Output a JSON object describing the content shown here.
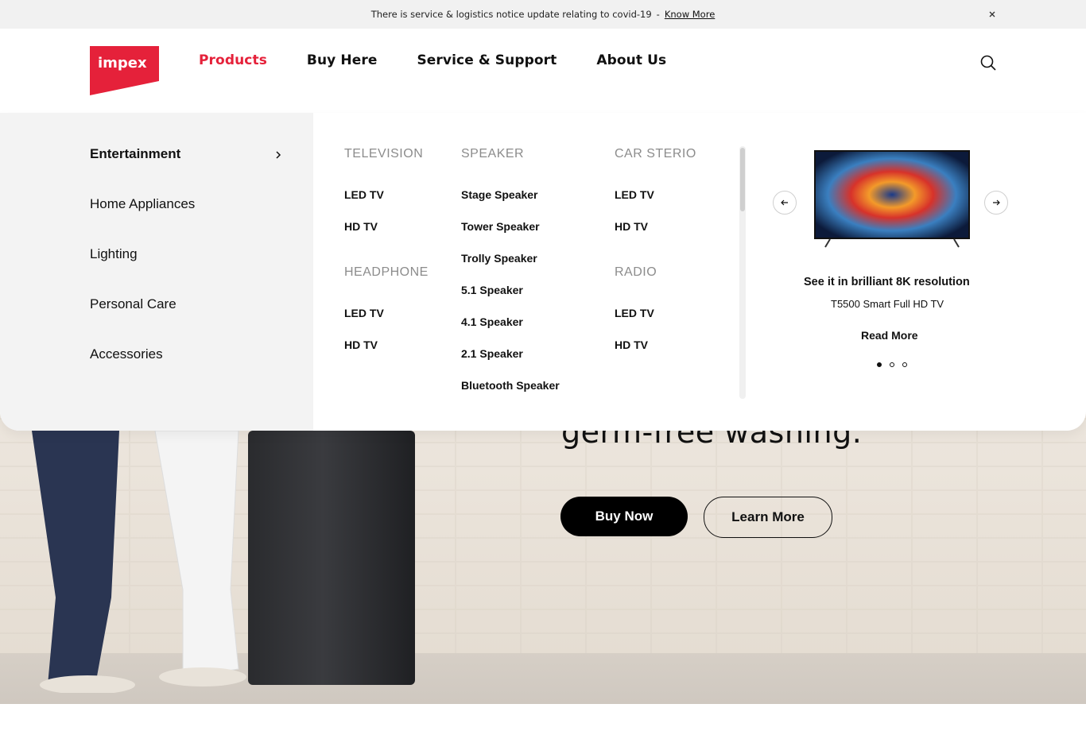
{
  "notice": {
    "text": "There is service & logistics notice update relating to covid-19",
    "separator": "-",
    "link": "Know More"
  },
  "brand": {
    "logo_text": "impex",
    "accent": "#e5213a"
  },
  "nav": {
    "items": [
      {
        "label": "Products",
        "active": true
      },
      {
        "label": "Buy Here"
      },
      {
        "label": "Service & Support"
      },
      {
        "label": "About Us"
      }
    ]
  },
  "categories": [
    {
      "label": "Entertainment",
      "active": true
    },
    {
      "label": "Home Appliances"
    },
    {
      "label": "Lighting"
    },
    {
      "label": "Personal Care"
    },
    {
      "label": "Accessories"
    }
  ],
  "columns": {
    "television": {
      "heading": "TELEVISION",
      "links": [
        "LED TV",
        "HD TV"
      ]
    },
    "headphone": {
      "heading": "HEADPHONE",
      "links": [
        "LED TV",
        "HD TV"
      ]
    },
    "speaker": {
      "heading": "SPEAKER",
      "links": [
        "Stage Speaker",
        "Tower Speaker",
        "Trolly Speaker",
        "5.1 Speaker",
        "4.1 Speaker",
        "2.1 Speaker",
        "Bluetooth Speaker"
      ]
    },
    "car": {
      "heading": "CAR STERIO",
      "links": [
        "LED TV",
        "HD TV"
      ]
    },
    "radio": {
      "heading": "RADIO",
      "links": [
        "LED TV",
        "HD TV"
      ]
    }
  },
  "promo": {
    "title": "See it in brilliant 8K resolution",
    "subtitle": "T5500 Smart Full HD TV",
    "cta": "Read More",
    "slides": 3,
    "active_slide": 1
  },
  "hero": {
    "headline_tail": "germ-free washing.",
    "primary_cta": "Buy Now",
    "secondary_cta": "Learn More"
  }
}
